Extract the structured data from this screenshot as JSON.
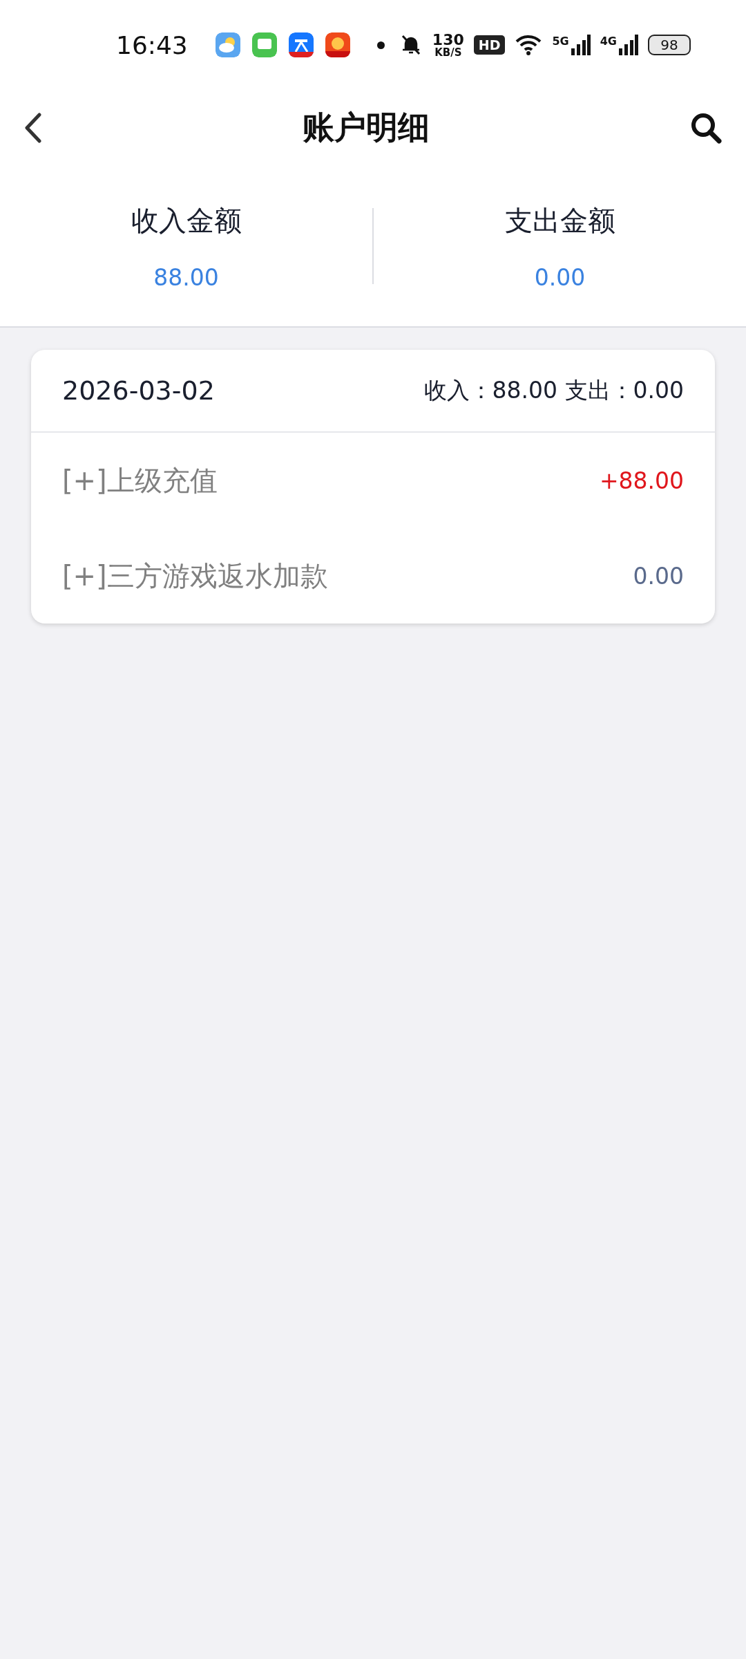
{
  "status_bar": {
    "time": "16:43",
    "net_speed": "130",
    "net_unit": "KB/S",
    "hd": "HD",
    "signals": [
      "5G",
      "4G"
    ],
    "battery": "98"
  },
  "header": {
    "title": "账户明细"
  },
  "summary": [
    {
      "label": "收入金额",
      "value": "88.00"
    },
    {
      "label": "支出金额",
      "value": "0.00"
    }
  ],
  "days": [
    {
      "date": "2026-03-02",
      "totals": "收入：88.00 支出：0.00",
      "entries": [
        {
          "label": "[+]上级充值",
          "amount": "+88.00",
          "kind": "credit"
        },
        {
          "label": "[+]三方游戏返水加款",
          "amount": "0.00",
          "kind": "zero"
        }
      ]
    }
  ]
}
